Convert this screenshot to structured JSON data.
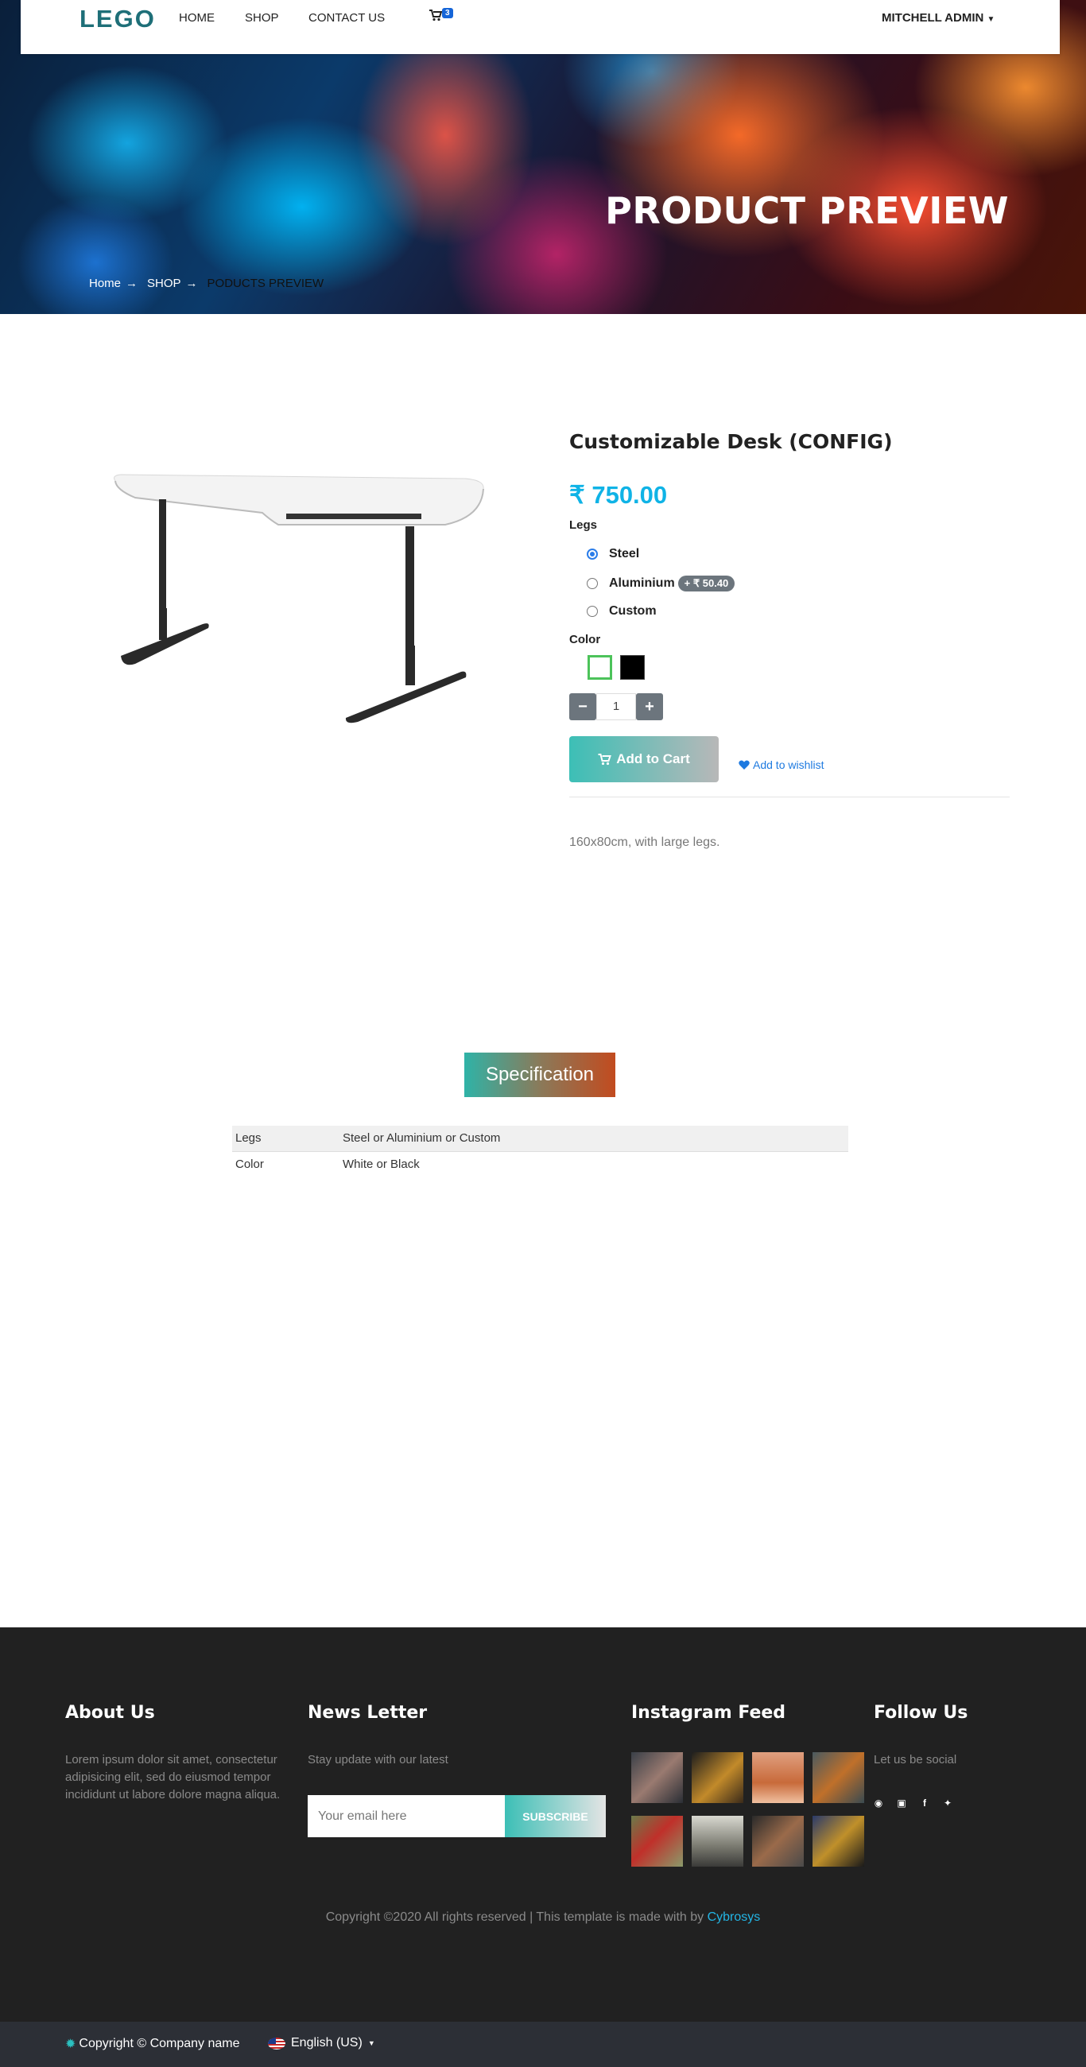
{
  "nav": {
    "logo": "LEGO",
    "links": [
      "HOME",
      "SHOP",
      "CONTACT US"
    ],
    "cart_count": "3",
    "user": "MITCHELL ADMIN"
  },
  "hero": {
    "title": "PRODUCT PREVIEW",
    "breadcrumb": [
      "Home",
      "SHOP",
      "PODUCTS PREVIEW"
    ]
  },
  "product": {
    "name": "Customizable Desk (CONFIG)",
    "price": "₹ 750.00",
    "legs_label": "Legs",
    "legs_options": [
      {
        "label": "Steel",
        "checked": true
      },
      {
        "label": "Aluminium",
        "extra": "+ ₹ 50.40"
      },
      {
        "label": "Custom"
      }
    ],
    "color_label": "Color",
    "colors": [
      "#ffffff",
      "#000000"
    ],
    "quantity": "1",
    "add_to_cart": "Add to Cart",
    "wishlist": "Add to wishlist",
    "description": "160x80cm, with large legs."
  },
  "specification": {
    "tab": "Specification",
    "rows": [
      {
        "name": "Legs",
        "value": "Steel or Aluminium or Custom"
      },
      {
        "name": "Color",
        "value": "White or Black"
      }
    ]
  },
  "footer": {
    "about_title": "About Us",
    "about_text": "Lorem ipsum dolor sit amet, consectetur adipisicing elit, sed do eiusmod tempor incididunt ut labore dolore magna aliqua.",
    "news_title": "News Letter",
    "news_text": "Stay update with our latest",
    "email_placeholder": "Your email here",
    "subscribe": "SUBSCRIBE",
    "instagram_title": "Instagram Feed",
    "follow_title": "Follow Us",
    "follow_text": "Let us be social",
    "copyright": "Copyright ©2020 All rights reserved | This template is made with by",
    "copyright_brand": "Cybrosys"
  },
  "bottom_bar": {
    "copyright": "Copyright © Company name",
    "language": "English (US)"
  }
}
